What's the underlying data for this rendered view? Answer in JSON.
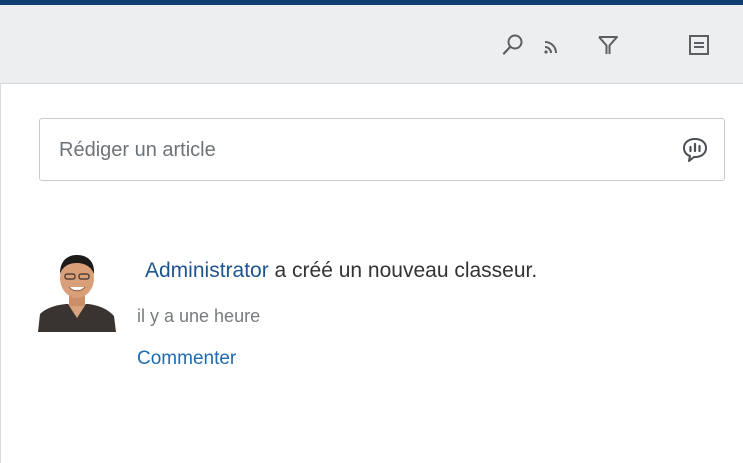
{
  "toolbar": {
    "buttons": [
      {
        "icon": "search-icon"
      },
      {
        "icon": "rss-feed-icon"
      },
      {
        "icon": "filter-icon"
      },
      {
        "icon": "list-view-icon"
      }
    ]
  },
  "composer": {
    "placeholder": "Rédiger un article",
    "icon": "comment-bubble-icon"
  },
  "activity": {
    "actor": "Administrator",
    "action": " a créé un nouveau classeur.",
    "timestamp": "il y a une heure",
    "comment_label": "Commenter"
  },
  "colors": {
    "top_accent": "#0f3e73",
    "toolbar_bg": "#eceef0",
    "link": "#1f5590",
    "icon": "#5b5f64"
  }
}
